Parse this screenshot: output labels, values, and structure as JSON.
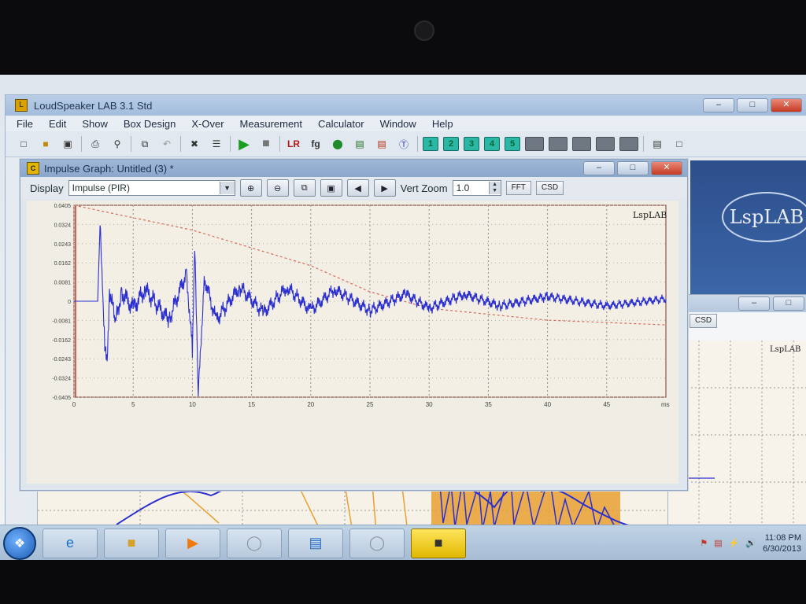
{
  "app": {
    "title": "LoudSpeaker LAB 3.1 Std",
    "menu": [
      "File",
      "Edit",
      "Show",
      "Box Design",
      "X-Over",
      "Measurement",
      "Calculator",
      "Window",
      "Help"
    ],
    "toolbar_numbers": [
      "1",
      "2",
      "3",
      "4",
      "5"
    ],
    "window_controls": [
      "–",
      "□",
      "✕"
    ]
  },
  "logo_text": "LspLAB",
  "impulse_window": {
    "title": "Impulse Graph: Untitled (3) *",
    "display_label": "Display",
    "display_value": "Impulse (PIR)",
    "vert_zoom_label": "Vert Zoom",
    "vert_zoom_value": "1.0",
    "fft_button": "FFT",
    "csd_button": "CSD",
    "plot_watermark": "LspLAB",
    "x_unit": "ms"
  },
  "second_window": {
    "csd_button": "CSD",
    "plot_watermark": "LspLAB"
  },
  "taskbar": {
    "time": "11:08 PM",
    "date": "6/30/2013"
  },
  "chart_data": [
    {
      "type": "line",
      "title": "",
      "xlabel": "ms",
      "ylabel": "",
      "xlim": [
        0,
        50
      ],
      "ylim": [
        -0.0405,
        0.0405
      ],
      "xticks": [
        0,
        5,
        10,
        15,
        20,
        25,
        30,
        35,
        40,
        45
      ],
      "yticks": [
        "0.0405",
        "0.0324",
        "0.0243",
        "0.0162",
        "0.0081",
        "0",
        "-0.0081",
        "-0.0162",
        "-0.0243",
        "-0.0324",
        "-0.0405"
      ],
      "grid": true,
      "series": [
        {
          "color": "#2b2fd0",
          "x": [
            0,
            1.5,
            2.0,
            2.2,
            2.4,
            2.6,
            2.8,
            3.0,
            3.5,
            4,
            5,
            6,
            8,
            9.5,
            10,
            10.2,
            10.5,
            11,
            12,
            14,
            16,
            18,
            20,
            22,
            25,
            28,
            30,
            33,
            36,
            40,
            45,
            50
          ],
          "values": [
            0,
            0,
            0,
            0.032,
            0.01,
            -0.02,
            -0.028,
            0.006,
            -0.01,
            0.004,
            -0.003,
            0.005,
            -0.008,
            0.012,
            -0.02,
            0.022,
            -0.04,
            0.01,
            -0.008,
            0.006,
            -0.005,
            0.006,
            -0.004,
            0.005,
            -0.004,
            0.003,
            -0.003,
            0.003,
            -0.002,
            0.002,
            -0.002,
            0.001
          ]
        },
        {
          "color": "#d86a5c",
          "style": "dashed",
          "x": [
            0,
            10,
            20,
            25,
            30,
            40,
            50
          ],
          "values": [
            0.0405,
            0.03,
            0.015,
            0.004,
            -0.003,
            -0.008,
            -0.01
          ]
        }
      ]
    }
  ]
}
